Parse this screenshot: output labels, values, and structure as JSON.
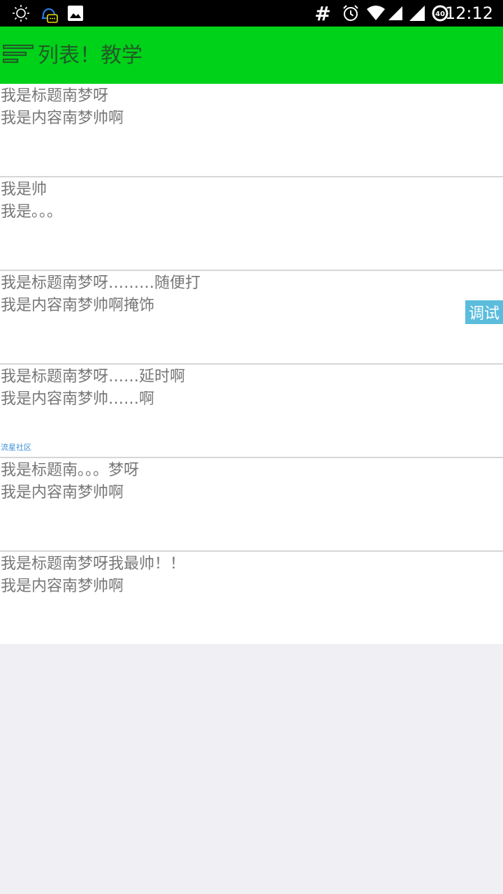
{
  "status_bar": {
    "time": "12:12",
    "battery_level": "40",
    "icons": [
      "brightness-icon",
      "qq-notification-icon",
      "image-icon",
      "hash-icon",
      "alarm-icon",
      "wifi-icon",
      "signal-icon",
      "signal-icon-2",
      "battery-icon"
    ]
  },
  "app_bar": {
    "title": "列表！教学",
    "background": "#00d21a"
  },
  "list": {
    "items": [
      {
        "title": "我是标题南梦呀",
        "content": "我是内容南梦帅啊"
      },
      {
        "title": "我是帅",
        "content": "我是。。。"
      },
      {
        "title": "我是标题南梦呀………随便打",
        "content": "我是内容南梦帅啊掩饰"
      },
      {
        "title": "我是标题南梦呀……延时啊",
        "content": "我是内容南梦帅……啊"
      },
      {
        "title": "我是标题南。。。梦呀",
        "content": "我是内容南梦帅啊"
      },
      {
        "title": "我是标题南梦呀我最帅！！",
        "content": "我是内容南梦帅啊"
      }
    ]
  },
  "debug_button": {
    "label": "调试"
  },
  "watermark": {
    "text": "流星社区"
  }
}
